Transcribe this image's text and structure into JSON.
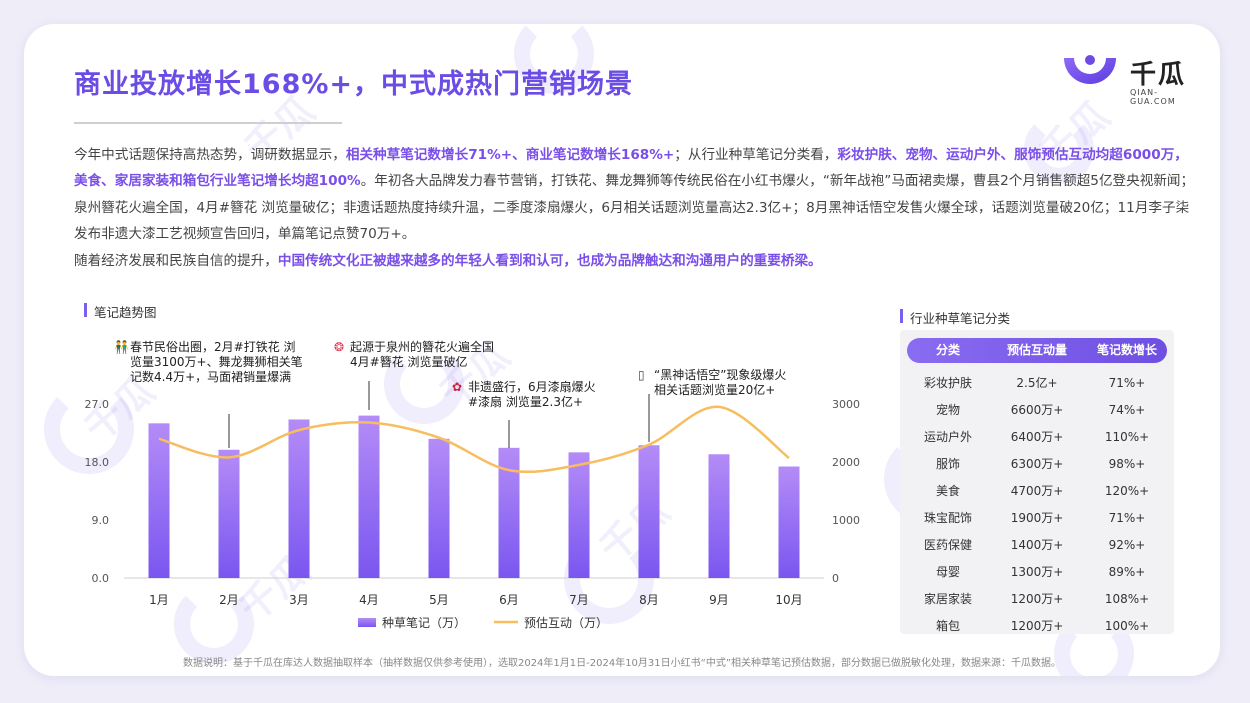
{
  "title": "商业投放增长168%+，中式成热门营销场景",
  "logo": {
    "cn": "千瓜",
    "en": "QIAN-GUA.COM"
  },
  "intro": {
    "p1": [
      {
        "t": "今年中式话题保持高热态势，调研数据显示，",
        "h": false
      },
      {
        "t": "相关种草笔记数增长71%+、商业笔记数增长168%+",
        "h": true
      },
      {
        "t": "；从行业种草笔记分类看，",
        "h": false
      },
      {
        "t": "彩妆护肤、宠物、运动户外、服饰预估互动均超6000万，美食、家居家装和箱包行业笔记增长均超100%",
        "h": true
      },
      {
        "t": "。年初各大品牌发力春节营销，打铁花、舞龙舞狮等传统民俗在小红书爆火，“新年战袍”马面裙卖爆，曹县2个月销售额超5亿登央视新闻；泉州簪花火遍全国，4月#簪花 浏览量破亿；非遗话题热度持续升温，二季度漆扇爆火，6月相关话题浏览量高达2.3亿+；8月黑神话悟空发售火爆全球，话题浏览量破20亿；11月李子柒发布非遗大漆工艺视频宣告回归，单篇笔记点赞70万+。",
        "h": false
      }
    ],
    "p2": [
      {
        "t": "随着经济发展和民族自信的提升，",
        "h": false
      },
      {
        "t": "中国传统文化正被越来越多的年轻人看到和认可，也成为品牌触达和沟通用户的重要桥梁。",
        "h": true
      }
    ]
  },
  "trend_title": "笔记趋势图",
  "table_title": "行业种草笔记分类",
  "annotations": [
    {
      "icon": "👬",
      "lines": [
        "春节民俗出圈，2月#打铁花 浏",
        "览量3100万+、舞龙舞狮相关笔",
        "记数4.4万+，马面裙销量爆满"
      ]
    },
    {
      "icon": "❂",
      "lines": [
        "起源于泉州的簪花火遍全国",
        "4月#簪花 浏览量破亿"
      ]
    },
    {
      "icon": "✿",
      "lines": [
        "非遗盛行，6月漆扇爆火",
        "#漆扇 浏览量2.3亿+"
      ]
    },
    {
      "icon": "▯",
      "lines": [
        "“黑神话悟空”现象级爆火",
        "相关话题浏览量20亿+"
      ]
    }
  ],
  "chart_data": {
    "type": "bar",
    "categories": [
      "1月",
      "2月",
      "3月",
      "4月",
      "5月",
      "6月",
      "7月",
      "8月",
      "9月",
      "10月"
    ],
    "series": [
      {
        "name": "种草笔记（万）",
        "type": "bar",
        "axis": "left",
        "values": [
          24.0,
          19.9,
          24.6,
          25.2,
          21.6,
          20.2,
          19.5,
          20.6,
          19.2,
          17.3
        ]
      },
      {
        "name": "预估互动（万）",
        "type": "line",
        "axis": "right",
        "values": [
          2400,
          2080,
          2550,
          2680,
          2420,
          1860,
          1950,
          2300,
          2950,
          2070
        ]
      }
    ],
    "y_left": {
      "ticks": [
        "0.0",
        "9.0",
        "18.0",
        "27.0"
      ],
      "lim": [
        0,
        27
      ]
    },
    "y_right": {
      "ticks": [
        "0",
        "1000",
        "2000",
        "3000"
      ],
      "lim": [
        0,
        3000
      ]
    },
    "legend": "bottom",
    "grid": false,
    "colors": {
      "bar_top": "#b48cf7",
      "bar_bottom": "#7a56f0",
      "line": "#f7bd5e"
    }
  },
  "table": {
    "headers": [
      "分类",
      "预估互动量",
      "笔记数增长"
    ],
    "rows": [
      [
        "彩妆护肤",
        "2.5亿+",
        "71%+"
      ],
      [
        "宠物",
        "6600万+",
        "74%+"
      ],
      [
        "运动户外",
        "6400万+",
        "110%+"
      ],
      [
        "服饰",
        "6300万+",
        "98%+"
      ],
      [
        "美食",
        "4700万+",
        "120%+"
      ],
      [
        "珠宝配饰",
        "1900万+",
        "71%+"
      ],
      [
        "医药保健",
        "1400万+",
        "92%+"
      ],
      [
        "母婴",
        "1300万+",
        "89%+"
      ],
      [
        "家居家装",
        "1200万+",
        "108%+"
      ],
      [
        "箱包",
        "1200万+",
        "100%+"
      ]
    ]
  },
  "footnote": "数据说明：基于千瓜在库达人数据抽取样本（抽样数据仅供参考使用），选取2024年1月1日-2024年10月31日小红书“中式”相关种草笔记预估数据，部分数据已做脱敏化处理，数据来源：千瓜数据。",
  "colors": {
    "accent": "#6b4de6",
    "highlight": "#7a4ee8"
  }
}
